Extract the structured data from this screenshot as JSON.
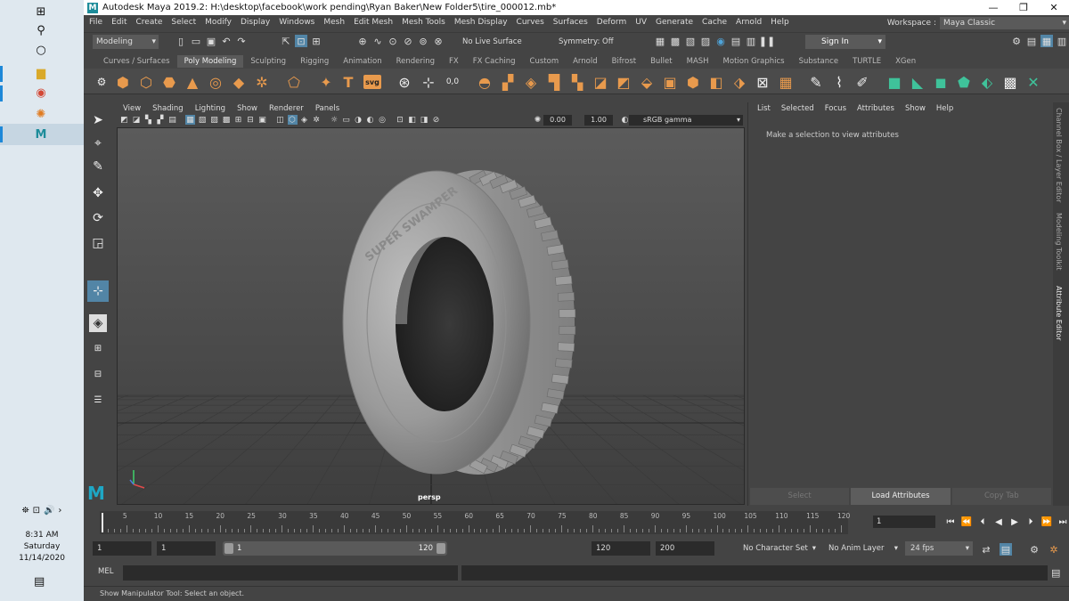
{
  "taskbar": {
    "icons": [
      {
        "name": "windows-start-icon",
        "glyph": "⊞"
      },
      {
        "name": "search-icon",
        "glyph": "⚲"
      },
      {
        "name": "cortana-icon",
        "glyph": "○"
      },
      {
        "name": "file-explorer-icon",
        "glyph": "▆"
      },
      {
        "name": "chrome-icon",
        "glyph": "◉"
      },
      {
        "name": "blender-icon",
        "glyph": "✺"
      },
      {
        "name": "maya-taskbar-icon",
        "glyph": "M"
      }
    ],
    "tray_icons": [
      "⛯",
      "⊡",
      "🔊",
      "›"
    ],
    "clock": {
      "time": "8:31 AM",
      "day": "Saturday",
      "date": "11/14/2020"
    },
    "notification_glyph": "▤"
  },
  "window": {
    "title": "Autodesk Maya 2019.2: H:\\desktop\\facebook\\work pending\\Ryan Baker\\New Folder5\\tire_000012.mb*",
    "logo": "M",
    "controls": [
      "—",
      "❐",
      "✕"
    ]
  },
  "menubar": {
    "items": [
      "File",
      "Edit",
      "Create",
      "Select",
      "Modify",
      "Display",
      "Windows",
      "Mesh",
      "Edit Mesh",
      "Mesh Tools",
      "Mesh Display",
      "Curves",
      "Surfaces",
      "Deform",
      "UV",
      "Generate",
      "Cache",
      "Arnold",
      "Help"
    ],
    "workspace_label": "Workspace :",
    "workspace_value": "Maya Classic"
  },
  "statusline": {
    "menuset": "Modeling",
    "live_surface": "No Live Surface",
    "symmetry": "Symmetry: Off",
    "sign_in": "Sign In"
  },
  "shelf": {
    "tabs": [
      "Curves / Surfaces",
      "Poly Modeling",
      "Sculpting",
      "Rigging",
      "Animation",
      "Rendering",
      "FX",
      "FX Caching",
      "Custom",
      "Arnold",
      "Bifrost",
      "Bullet",
      "MASH",
      "Motion Graphics",
      "Substance",
      "TURTLE",
      "XGen"
    ],
    "active_tab": "Poly Modeling",
    "svg_label": "svg",
    "text_label": "T"
  },
  "viewport": {
    "menu": [
      "View",
      "Shading",
      "Lighting",
      "Show",
      "Renderer",
      "Panels"
    ],
    "exposure": "0.00",
    "gamma": "1.00",
    "color_space": "sRGB gamma",
    "camera": "persp",
    "tire_text": "SUPER SWAMPER"
  },
  "attribute_editor": {
    "menu": [
      "List",
      "Selected",
      "Focus",
      "Attributes",
      "Show",
      "Help"
    ],
    "message": "Make a selection to view attributes",
    "buttons": [
      "Select",
      "Load Attributes",
      "Copy Tab"
    ]
  },
  "side_tabs": [
    "Channel Box / Layer Editor",
    "Modeling Toolkit",
    "Attribute Editor"
  ],
  "timeline": {
    "ticks": [
      5,
      10,
      15,
      20,
      25,
      30,
      35,
      40,
      45,
      50,
      55,
      60,
      65,
      70,
      75,
      80,
      85,
      90,
      95,
      100,
      105,
      110,
      115,
      120
    ],
    "current_frame": "1",
    "playhead_frame": 1
  },
  "range": {
    "start": "1",
    "start_inner": "1",
    "slider_start": "1",
    "slider_end": "120",
    "end_inner": "120",
    "end": "200",
    "character_set": "No Character Set",
    "anim_layer": "No Anim Layer",
    "fps": "24 fps"
  },
  "command_line": {
    "language": "MEL"
  },
  "help_line": "Show Manipulator Tool: Select an object."
}
